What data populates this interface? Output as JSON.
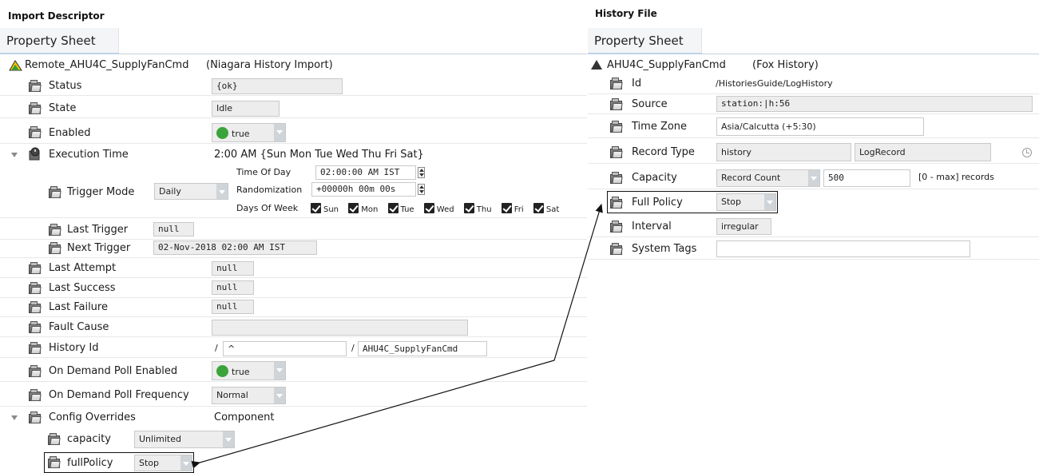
{
  "left": {
    "heading": "Import Descriptor",
    "tab": "Property Sheet",
    "root": {
      "name": "Remote_AHU4C_SupplyFanCmd",
      "type": "(Niagara History Import)"
    },
    "status": {
      "label": "Status",
      "value": "{ok}"
    },
    "state": {
      "label": "State",
      "value": "Idle"
    },
    "enabled": {
      "label": "Enabled",
      "value": "true"
    },
    "exec": {
      "label": "Execution Time",
      "summary": "2:00 AM {Sun Mon Tue Wed Thu Fri Sat}",
      "trigger_mode": {
        "label": "Trigger Mode",
        "value": "Daily"
      },
      "time_of_day": {
        "label": "Time Of Day",
        "value": "02:00:00 AM IST"
      },
      "randomization": {
        "label": "Randomization",
        "value": "+00000h 00m 00s"
      },
      "days": {
        "label": "Days Of Week",
        "items": [
          "Sun",
          "Mon",
          "Tue",
          "Wed",
          "Thu",
          "Fri",
          "Sat"
        ]
      },
      "last_trigger": {
        "label": "Last Trigger",
        "value": "null"
      },
      "next_trigger": {
        "label": "Next Trigger",
        "value": "02-Nov-2018 02:00 AM IST"
      }
    },
    "last_attempt": {
      "label": "Last Attempt",
      "value": "null"
    },
    "last_success": {
      "label": "Last Success",
      "value": "null"
    },
    "last_failure": {
      "label": "Last Failure",
      "value": "null"
    },
    "fault_cause": {
      "label": "Fault Cause",
      "value": ""
    },
    "history_id": {
      "label": "History Id",
      "sep1": "/",
      "device": "^",
      "sep2": "/",
      "name": "AHU4C_SupplyFanCmd"
    },
    "odp_enabled": {
      "label": "On Demand Poll Enabled",
      "value": "true"
    },
    "odp_frequency": {
      "label": "On Demand Poll Frequency",
      "value": "Normal"
    },
    "config": {
      "label": "Config Overrides",
      "value": "Component",
      "capacity": {
        "label": "capacity",
        "value": "Unlimited"
      },
      "full_policy": {
        "label": "fullPolicy",
        "value": "Stop"
      }
    }
  },
  "right": {
    "heading": "History File",
    "tab": "Property Sheet",
    "root": {
      "name": "AHU4C_SupplyFanCmd",
      "type": "(Fox History)"
    },
    "id": {
      "label": "Id",
      "value": "/HistoriesGuide/LogHistory"
    },
    "source": {
      "label": "Source",
      "value": "station:|h:56"
    },
    "timezone": {
      "label": "Time Zone",
      "value": "Asia/Calcutta (+5:30)"
    },
    "record_type": {
      "label": "Record Type",
      "value1": "history",
      "value2": "LogRecord"
    },
    "capacity": {
      "label": "Capacity",
      "mode": "Record Count",
      "value": "500",
      "note": "[0 - max] records"
    },
    "full_policy": {
      "label": "Full Policy",
      "value": "Stop"
    },
    "interval": {
      "label": "Interval",
      "value": "irregular"
    },
    "system_tags": {
      "label": "System Tags",
      "value": ""
    }
  },
  "colors": {
    "true_dot": "#3aa43a",
    "tab_bg": "#f4f5f7",
    "field_bg": "#ededed",
    "arrow": "#111111"
  }
}
